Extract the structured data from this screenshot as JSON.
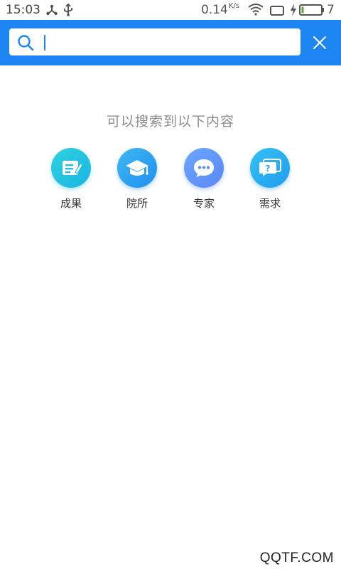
{
  "status_bar": {
    "time": "15:03",
    "net_speed": "0.14",
    "net_speed_unit": "K/s",
    "battery_level": "7",
    "icons": [
      "network-share-icon",
      "usb-icon",
      "wifi-icon",
      "screen-icon",
      "charging-icon",
      "battery-icon"
    ]
  },
  "header": {
    "background_color": "#1e86f2",
    "search": {
      "placeholder": "",
      "value": ""
    },
    "icons": [
      "search-icon",
      "close-icon"
    ]
  },
  "hint_text": "可以搜索到以下内容",
  "categories": [
    {
      "label": "成果",
      "icon": "results-icon",
      "color": "#22c3e3"
    },
    {
      "label": "院所",
      "icon": "graduation-cap-icon",
      "color": "#2a9ff1"
    },
    {
      "label": "专家",
      "icon": "chat-bubble-icon",
      "color": "#6196f8"
    },
    {
      "label": "需求",
      "icon": "question-bubble-icon",
      "color": "#2aaef2"
    }
  ],
  "watermark": "QQTF.COM"
}
